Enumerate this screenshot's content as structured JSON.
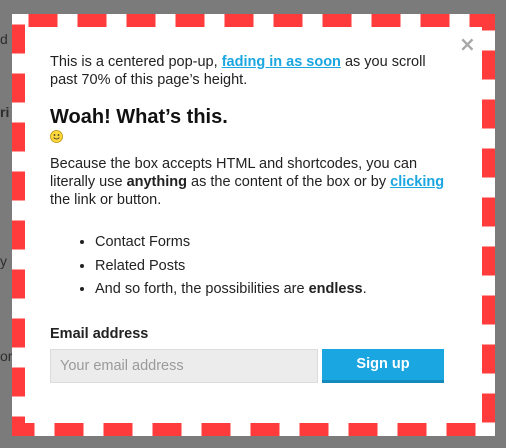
{
  "background": {
    "fragments": [
      "d t",
      "ri",
      "y",
      "or"
    ]
  },
  "popup": {
    "close_glyph": "×",
    "intro_before": "This is a centered pop-up, ",
    "intro_link": "fading in as soon",
    "intro_after": " as you scroll past 70% of this page’s height.",
    "heading": "Woah! What’s this.",
    "smiley_icon": "smiley-emoji",
    "para_before": "Because the box accepts HTML and shortcodes, you can literally use ",
    "para_bold": "anything",
    "para_middle": " as the content of the box or by ",
    "para_link": "clicking",
    "para_after": " the link or button.",
    "list": {
      "item1": "Contact Forms",
      "item2": "Related Posts",
      "item3_before": "And so forth, the possibilities are ",
      "item3_bold": "endless",
      "item3_after": "."
    },
    "form": {
      "label": "Email address",
      "email_placeholder": "Your email address",
      "email_value": "",
      "button_label": "Sign up"
    }
  },
  "colors": {
    "accent": "#1aa6e0",
    "border_dash": "#ff3b3b",
    "overlay": "#7b7b7b"
  }
}
